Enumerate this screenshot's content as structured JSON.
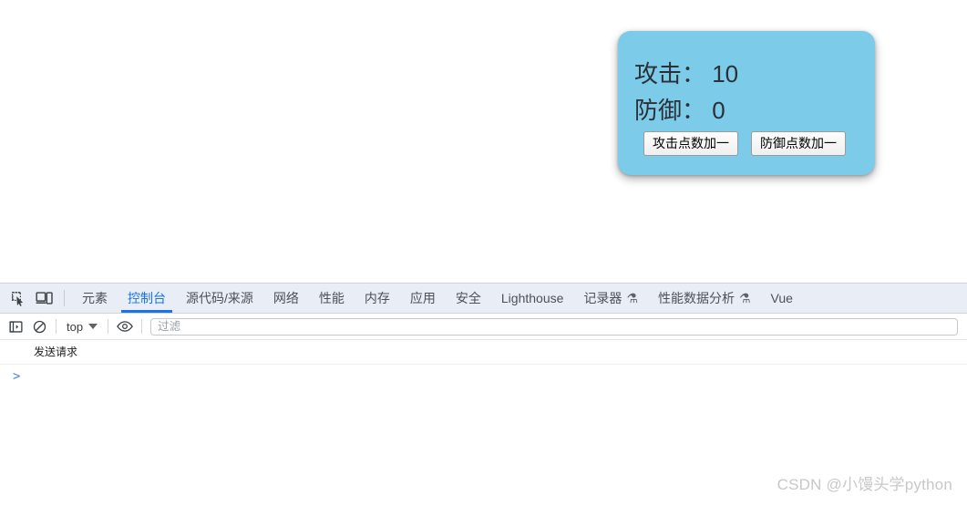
{
  "page": {
    "card": {
      "attack_label": "攻击：",
      "attack_value": "10",
      "defense_label": "防御：",
      "defense_value": "0",
      "attack_line": "攻击： 10",
      "defense_line": "防御： 0",
      "attack_button": "攻击点数加一",
      "defense_button": "防御点数加一",
      "background_color": "#7ccbe8",
      "text_color": "#2b3036"
    }
  },
  "devtools": {
    "inspect_icon": "inspect-element-icon",
    "device_icon": "device-toolbar-icon",
    "active_tab": "控制台",
    "accent_color": "#1a73e8",
    "tabs": [
      {
        "label": "元素",
        "beaker": ""
      },
      {
        "label": "控制台",
        "beaker": ""
      },
      {
        "label": "源代码/来源",
        "beaker": ""
      },
      {
        "label": "网络",
        "beaker": ""
      },
      {
        "label": "性能",
        "beaker": ""
      },
      {
        "label": "内存",
        "beaker": ""
      },
      {
        "label": "应用",
        "beaker": ""
      },
      {
        "label": "安全",
        "beaker": ""
      },
      {
        "label": "Lighthouse",
        "beaker": ""
      },
      {
        "label": "记录器",
        "beaker": "⚗"
      },
      {
        "label": "性能数据分析",
        "beaker": "⚗"
      },
      {
        "label": "Vue",
        "beaker": ""
      }
    ],
    "toolbar": {
      "sidebar_icon": "console-sidebar-icon",
      "clear_icon": "clear-console-icon",
      "context_value": "top",
      "eye_icon": "live-expression-eye-icon",
      "filter_placeholder": "过滤",
      "filter_value": ""
    },
    "console": {
      "messages": [
        {
          "text": "发送请求"
        }
      ],
      "prompt_symbol": ">"
    }
  },
  "watermark": {
    "text": "CSDN @小馒头学python"
  }
}
